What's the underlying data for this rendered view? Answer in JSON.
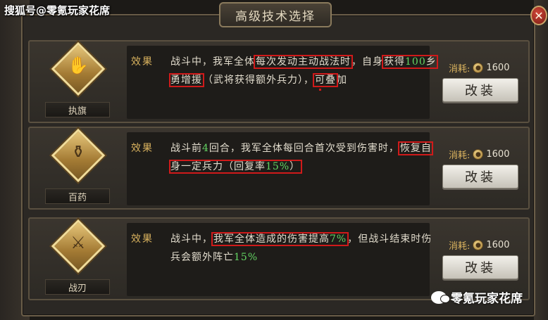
{
  "source_tag": "搜狐号@零氪玩家花席",
  "title": "高级技术选择",
  "close_icon": "✕",
  "effect_label": "效果",
  "cost_label": "消耗:",
  "watermark": "零氪玩家花席",
  "cards": [
    {
      "name": "执旗",
      "icon": "flag-hand-icon",
      "glyph": "✋",
      "desc": {
        "p1": "战斗中，我军全体",
        "h1": "每次发动主动战法时",
        "p2": "，自身",
        "h2a": "获得",
        "h2num": "100",
        "h2b": "乡勇增援",
        "p3": "（武将获得额外兵力）",
        "p4": "，",
        "h3": "可叠",
        "p5": "加"
      },
      "cost": "1600",
      "button": "改装"
    },
    {
      "name": "百药",
      "icon": "medicine-gourd-icon",
      "glyph": "⚱",
      "desc": {
        "p1a": "战斗前",
        "p1num": "4",
        "p1b": "回合，我军全体每回合首次受到伤害时，",
        "h1a": "恢复自身一定兵力（回复率",
        "h1num": "15%",
        "h1b": "）"
      },
      "cost": "1600",
      "button": "改装"
    },
    {
      "name": "战刃",
      "icon": "war-blade-icon",
      "glyph": "⚔",
      "desc": {
        "p1": "战斗中，",
        "h1a": "我军全体造成的伤害提高",
        "h1num": "7%",
        "p2": "，但战斗结束时伤兵会额外阵亡",
        "p2num": "15%"
      },
      "cost": "1600",
      "button": "改装"
    }
  ]
}
